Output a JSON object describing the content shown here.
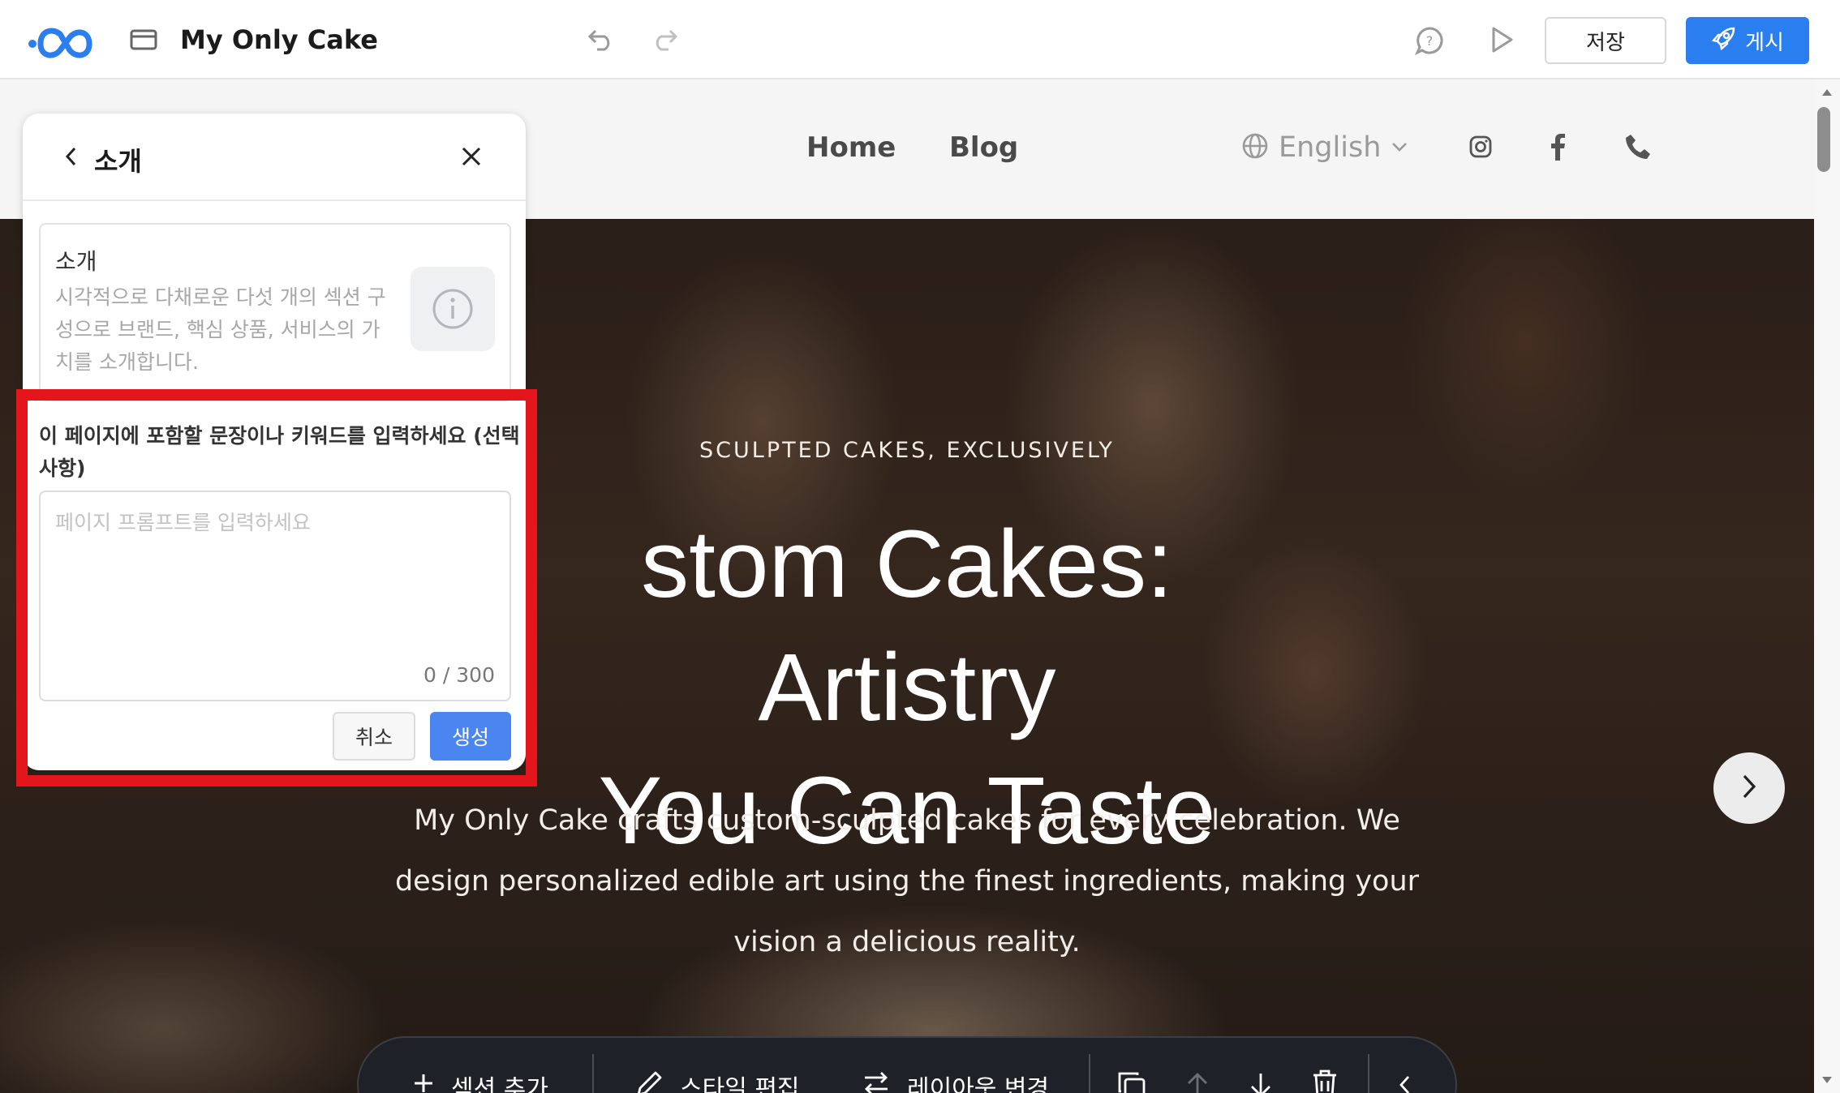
{
  "app": {
    "title": "My Only Cake",
    "save_label": "저장",
    "publish_label": "게시",
    "icons": [
      "logo-icon",
      "page-icon",
      "undo-icon",
      "redo-icon",
      "comment-icon",
      "play-icon",
      "rocket-icon"
    ]
  },
  "site": {
    "nav": {
      "links": [
        "Home",
        "Blog"
      ],
      "language": "English"
    },
    "hero": {
      "eyebrow": "SCULPTED CAKES, EXCLUSIVELY",
      "title_line1": "stom Cakes: Artistry",
      "title_line2": "You Can Taste",
      "description": "My Only Cake crafts custom-sculpted cakes for every celebration. We design personalized edible art using the finest ingredients, making your vision a delicious reality."
    }
  },
  "toolbar": {
    "add_section": "섹션 추가",
    "edit_style": "스타일 편집",
    "change_layout": "레이아웃 변경"
  },
  "panel": {
    "title": "소개",
    "card_title": "소개",
    "card_description": "시각적으로 다채로운 다섯 개의 섹션 구성으로 브랜드, 핵심 상품, 서비스의 가치를 소개합니다.",
    "prompt_label": "이 페이지에 포함할 문장이나 키워드를 입력하세요 (선택 사항)",
    "prompt_placeholder": "페이지 프롬프트를 입력하세요",
    "counter": "0 / 300",
    "cancel_label": "취소",
    "generate_label": "생성"
  },
  "colors": {
    "accent": "#2a7ef0",
    "generate": "#4a85f0",
    "highlight": "#e3171b",
    "toolbar_bg": "#1e2228"
  }
}
